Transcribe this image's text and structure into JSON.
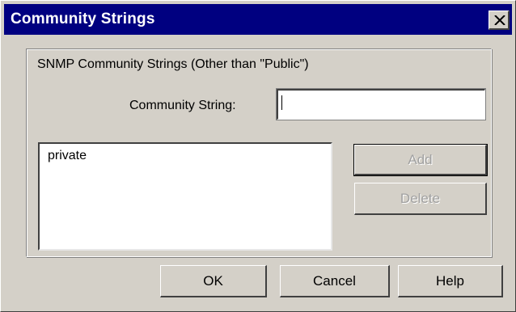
{
  "window": {
    "title": "Community Strings",
    "close_icon": "close-icon"
  },
  "group": {
    "label": "SNMP Community Strings (Other than \"Public\")"
  },
  "field": {
    "label": "Community String:",
    "value": ""
  },
  "list": {
    "items": [
      "private"
    ]
  },
  "buttons": {
    "add": "Add",
    "delete": "Delete",
    "ok": "OK",
    "cancel": "Cancel",
    "help": "Help"
  },
  "colors": {
    "titlebar": "#000080",
    "face": "#d4d0c8"
  }
}
